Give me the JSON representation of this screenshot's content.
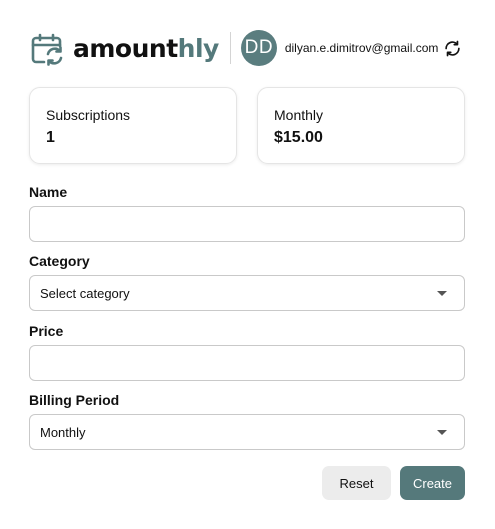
{
  "header": {
    "logo_part1": "amount",
    "logo_part2": "hly",
    "avatar_initials": "DD",
    "email": "dilyan.e.dimitrov@gmail.com",
    "logo_icon": "calendar-sync-icon",
    "refresh_icon": "refresh-icon"
  },
  "stats": [
    {
      "label": "Subscriptions",
      "value": "1"
    },
    {
      "label": "Monthly",
      "value": "$15.00"
    }
  ],
  "form": {
    "name": {
      "label": "Name",
      "value": "",
      "placeholder": ""
    },
    "category": {
      "label": "Category",
      "value": "Select category"
    },
    "price": {
      "label": "Price",
      "value": "",
      "placeholder": ""
    },
    "billing_period": {
      "label": "Billing Period",
      "value": "Monthly"
    }
  },
  "buttons": {
    "reset": "Reset",
    "create": "Create"
  },
  "colors": {
    "accent": "#55797b",
    "avatar": "#5a7d7f",
    "reset_bg": "#ececec"
  }
}
